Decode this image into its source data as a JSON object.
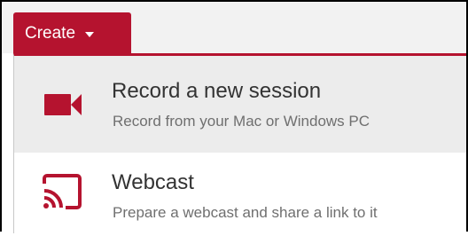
{
  "create_button": {
    "label": "Create",
    "icon": "caret-down-icon"
  },
  "menu": {
    "items": [
      {
        "title": "Record a new session",
        "subtitle": "Record from your Mac or Windows PC",
        "icon": "video-camera-icon",
        "highlighted": true
      },
      {
        "title": "Webcast",
        "subtitle": "Prepare a webcast and share a link to it",
        "icon": "cast-icon",
        "highlighted": false
      }
    ]
  },
  "colors": {
    "accent": "#b5132f",
    "highlight_bg": "#ececec",
    "title_text": "#333333",
    "subtitle_text": "#6f6f6f"
  }
}
